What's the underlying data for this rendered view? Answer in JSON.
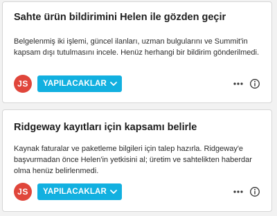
{
  "cards": [
    {
      "title": "Sahte ürün bildirimini Helen ile gözden geçir",
      "description": "Belgelenmiş iki işlemi, güncel ilanları, uzman bulgularını ve Summit'in kapsam dışı tutulmasını incele. Henüz herhangi bir bildirim gönderilmedi.",
      "assignee_initials": "JS",
      "status_label": "YAPILACAKLAR"
    },
    {
      "title": "Ridgeway kayıtları için kapsamı belirle",
      "description": "Kaynak faturalar ve paketleme bilgileri için talep hazırla. Ridgeway'e başvurmadan önce Helen'in yetkisini al; üretim ve sahtelikten haberdar olma henüz belirlenmedi.",
      "assignee_initials": "JS",
      "status_label": "YAPILACAKLAR"
    }
  ],
  "icons": {
    "more": "more-horizontal-icon",
    "info": "info-icon",
    "chevron": "chevron-down-icon"
  },
  "colors": {
    "avatar": "#e0463b",
    "status_button": "#12b0e0",
    "card_border": "#d6d6d6",
    "background": "#f2f2f2"
  }
}
